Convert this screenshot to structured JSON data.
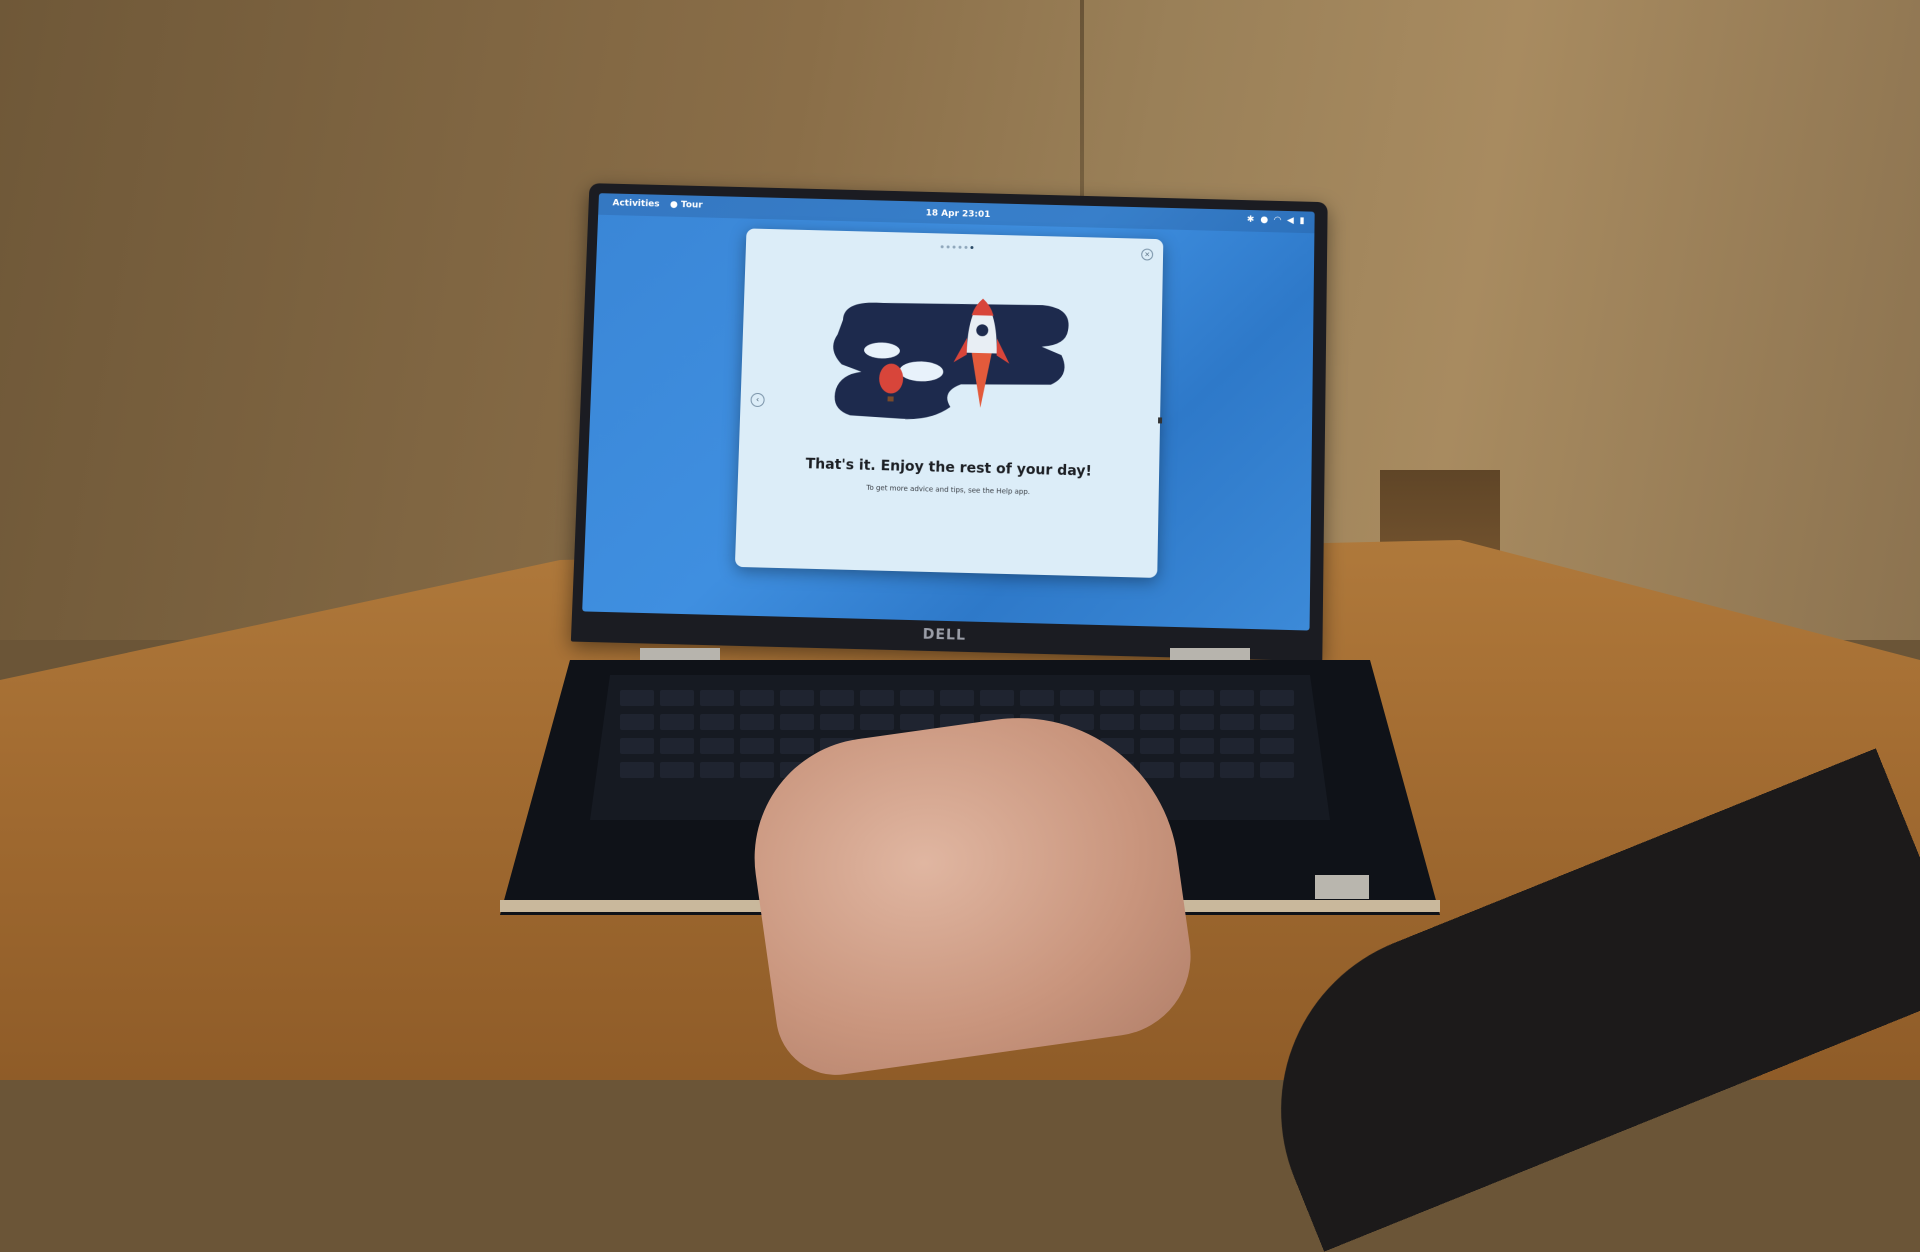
{
  "top_bar": {
    "activities_label": "Activities",
    "app_menu_label": "Tour",
    "clock": "18 Apr 23:01",
    "tray_icons": [
      "accessibility-icon",
      "location-icon",
      "wifi-icon",
      "volume-icon",
      "battery-icon"
    ]
  },
  "tour": {
    "title": "That's it. Enjoy the rest of your day!",
    "subtitle": "To get more advice and tips, see the Help app.",
    "page_count": 6,
    "active_page": 6
  },
  "brand": "DELL",
  "colors": {
    "desktop": "#3a86d6",
    "window_bg": "#dcedf8",
    "rocket_red": "#d8453a",
    "night_sky": "#1d2a4d"
  }
}
